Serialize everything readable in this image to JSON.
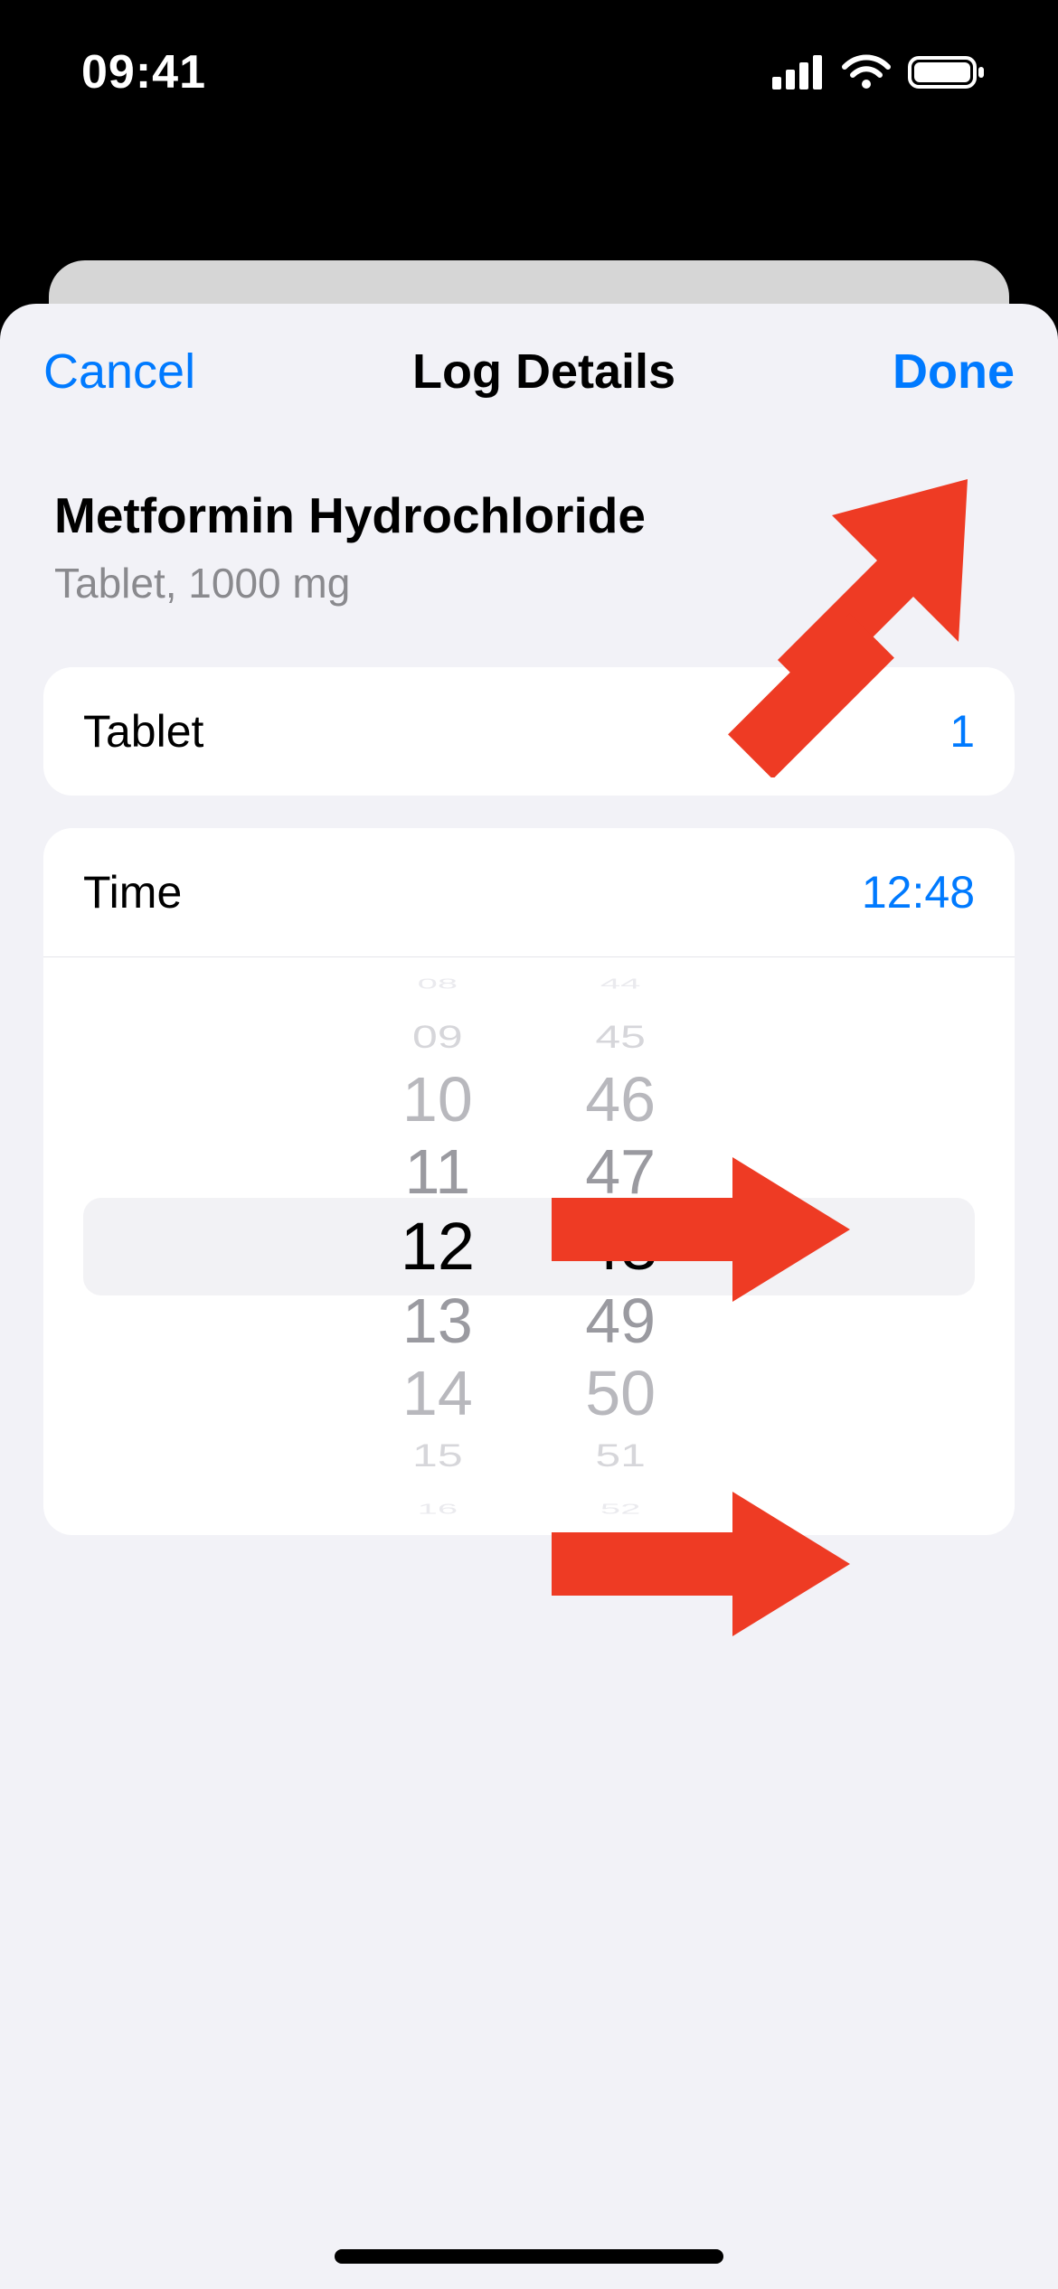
{
  "status": {
    "time": "09:41"
  },
  "header": {
    "cancel": "Cancel",
    "title": "Log Details",
    "done": "Done"
  },
  "medication": {
    "name": "Metformin Hydrochloride",
    "subtitle": "Tablet, 1000 mg"
  },
  "rows": {
    "dose_label": "Tablet",
    "dose_value": "1",
    "time_label": "Time",
    "time_value": "12:48"
  },
  "picker": {
    "hours": {
      "edge_top": "08",
      "far_top": "09",
      "up2": "10",
      "up1": "11",
      "sel": "12",
      "dn1": "13",
      "dn2": "14",
      "far_bot": "15",
      "edge_bot": "16"
    },
    "minutes": {
      "edge_top": "44",
      "far_top": "45",
      "up2": "46",
      "up1": "47",
      "sel": "48",
      "dn1": "49",
      "dn2": "50",
      "far_bot": "51",
      "edge_bot": "52"
    }
  },
  "colors": {
    "accent": "#007aff",
    "annotation": "#ee3b24"
  }
}
